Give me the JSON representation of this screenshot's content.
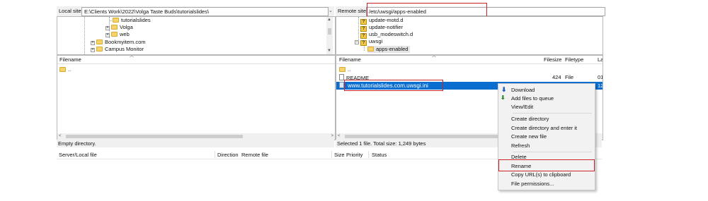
{
  "local": {
    "site_label": "Local site:",
    "site_path": "E:\\Clients Work\\2022\\Volga Taste Buds\\tutorialslides\\",
    "tree": [
      "tutorialslides",
      "Volga",
      "web",
      "Bookmyitem.com",
      "Campus Monitor"
    ],
    "columns": {
      "filename": "Filename"
    },
    "files": [
      ".."
    ],
    "status": "Empty directory."
  },
  "remote": {
    "site_label": "Remote site:",
    "site_path": "/etc/uwsgi/apps-enabled",
    "tree": [
      "update-motd.d",
      "update-notifier",
      "usb_modeswitch.d",
      "uwsgi",
      "apps-enabled"
    ],
    "columns": {
      "filename": "Filename",
      "filesize": "Filesize",
      "filetype": "Filetype",
      "last": "La"
    },
    "files": [
      {
        "name": "..",
        "size": "",
        "type": "",
        "last": ""
      },
      {
        "name": "README",
        "size": "424",
        "type": "File",
        "last": "01/"
      },
      {
        "name": "www.tutorialslides.com.uwsgi.ini",
        "size": "",
        "type": "",
        "last": "12/"
      }
    ],
    "status": "Selected 1 file. Total size: 1,249 bytes"
  },
  "queue": {
    "columns": [
      "Server/Local file",
      "Direction",
      "Remote file",
      "Size",
      "Priority",
      "Status"
    ]
  },
  "context_menu": {
    "items": [
      "Download",
      "Add files to queue",
      "View/Edit",
      "Create directory",
      "Create directory and enter it",
      "Create new file",
      "Refresh",
      "Delete",
      "Rename",
      "Copy URL(s) to clipboard",
      "File permissions..."
    ],
    "highlighted": "Rename"
  },
  "colors": {
    "selection": "#0a6ed1",
    "highlight_border": "#c9242a",
    "folder": "#f7d46a"
  },
  "icons": {
    "download": "download-arrow-icon",
    "add_queue": "add-queue-icon"
  }
}
